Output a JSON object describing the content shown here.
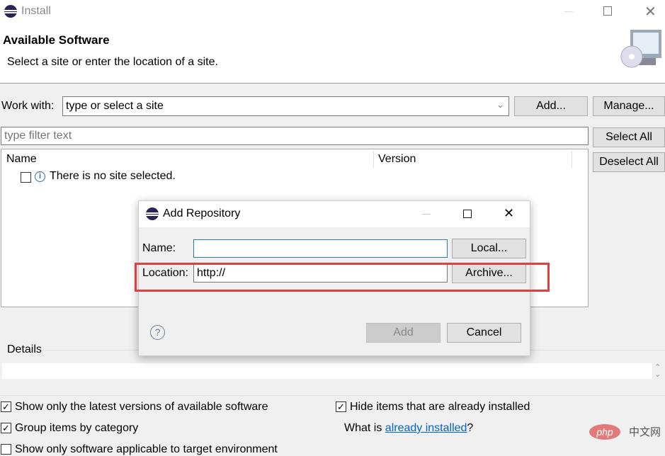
{
  "window": {
    "title": "Install"
  },
  "header": {
    "title": "Available Software",
    "subtitle": "Select a site or enter the location of a site."
  },
  "work_with": {
    "label": "Work with:",
    "placeholder": "type or select a site",
    "add": "Add...",
    "manage": "Manage..."
  },
  "filter": {
    "placeholder": "type filter text",
    "select_all": "Select All",
    "deselect_all": "Deselect All"
  },
  "table": {
    "columns": [
      "Name",
      "Version"
    ],
    "rows": [
      {
        "text": "There is no site selected.",
        "checked": false
      }
    ]
  },
  "details": {
    "label": "Details"
  },
  "options": {
    "latest": {
      "label": "Show only the latest versions of available software",
      "checked": true
    },
    "group": {
      "label": "Group items by category",
      "checked": true
    },
    "target": {
      "label": "Show only software applicable to target environment",
      "checked": false
    },
    "hide": {
      "label": "Hide items that are already installed",
      "checked": true
    },
    "what_is": "What is ",
    "link": "already installed",
    "q": "?"
  },
  "dialog": {
    "title": "Add Repository",
    "name_label": "Name:",
    "name_value": "",
    "location_label": "Location:",
    "location_value": "http://",
    "local": "Local...",
    "archive": "Archive...",
    "add": "Add",
    "cancel": "Cancel"
  },
  "colors": {
    "highlight": "#e04040",
    "link": "#0066cc",
    "focus": "#2a7ab0"
  },
  "watermark": "php 中文网"
}
